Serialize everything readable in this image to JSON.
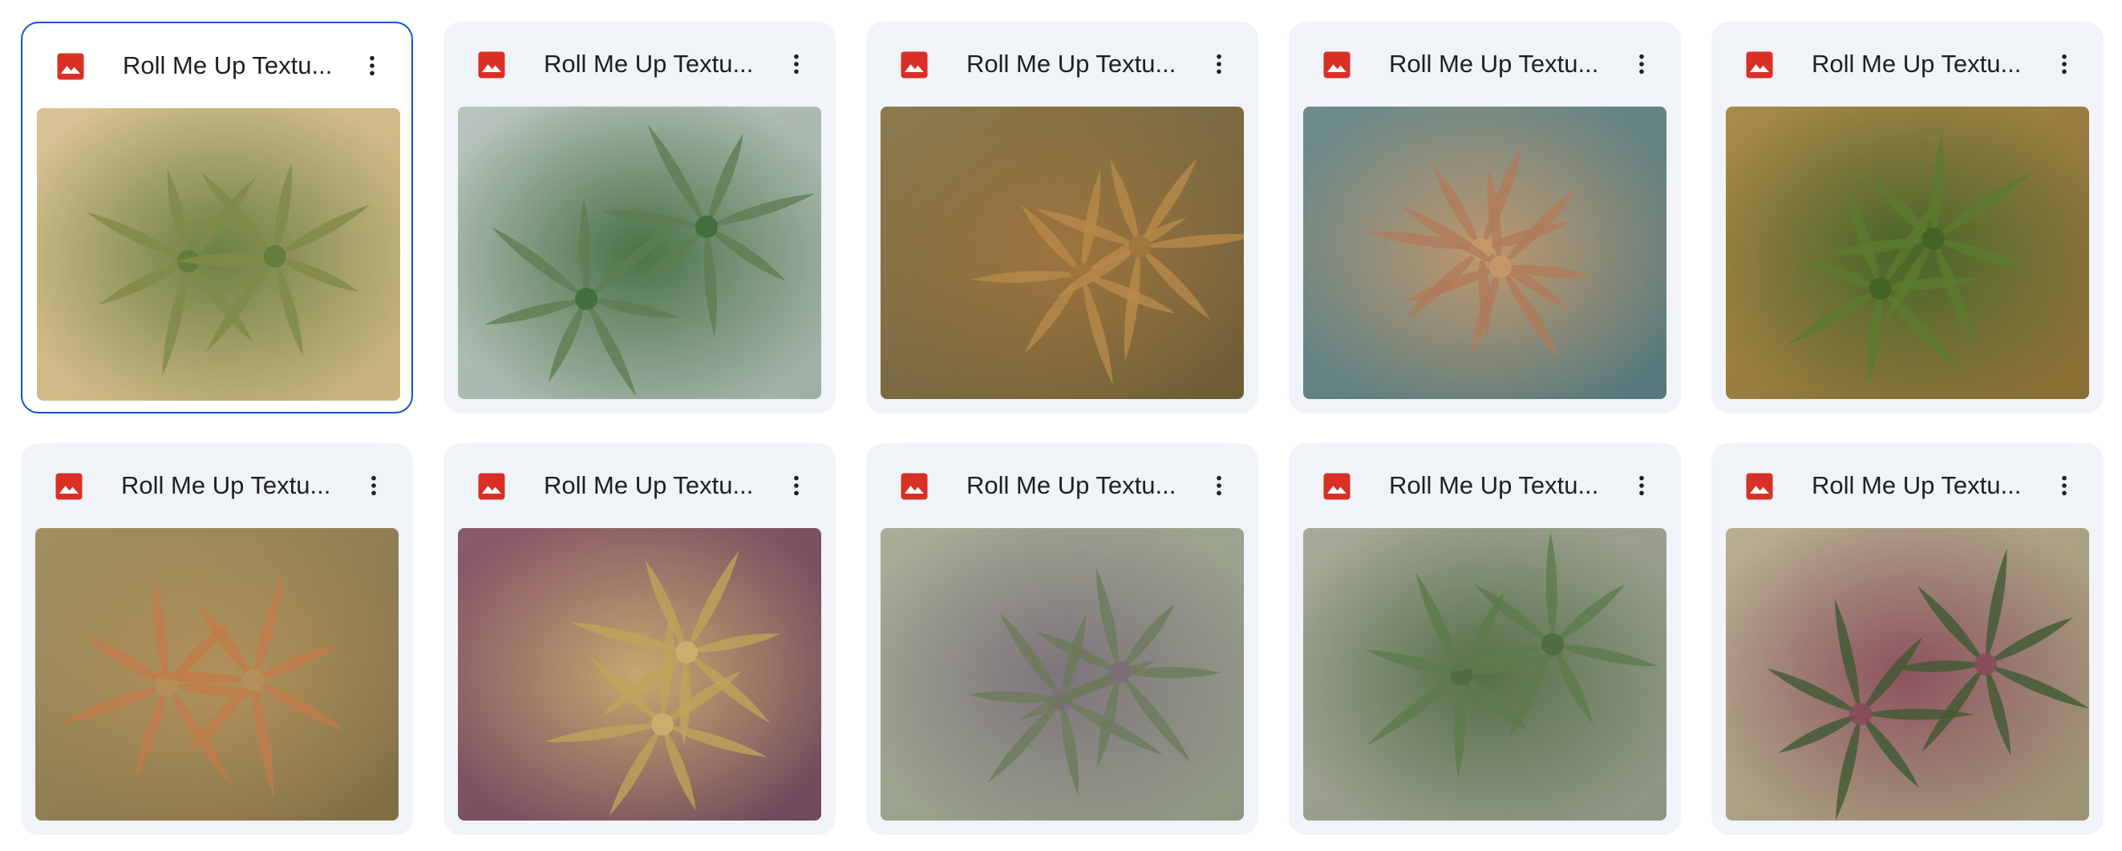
{
  "files": [
    {
      "title": "Roll Me Up Textu...",
      "selected": true,
      "icon": "image-file-icon",
      "colors": [
        "#d9c296",
        "#c8b27c",
        "#7f8a4a",
        "#5f7a3a"
      ]
    },
    {
      "title": "Roll Me Up Textu...",
      "selected": false,
      "icon": "image-file-icon",
      "colors": [
        "#b8c4bd",
        "#9fb0a6",
        "#5e7d52",
        "#3f6a3a"
      ]
    },
    {
      "title": "Roll Me Up Textu...",
      "selected": false,
      "icon": "image-file-icon",
      "colors": [
        "#8a7a4e",
        "#6d5c36",
        "#b88a4a",
        "#a0743c"
      ]
    },
    {
      "title": "Roll Me Up Textu...",
      "selected": false,
      "icon": "image-file-icon",
      "colors": [
        "#6f8c8c",
        "#56787a",
        "#b07a5a",
        "#c99a6a"
      ]
    },
    {
      "title": "Roll Me Up Textu...",
      "selected": false,
      "icon": "image-file-icon",
      "colors": [
        "#a88a4a",
        "#8a6e34",
        "#5b7a2e",
        "#3f6326"
      ]
    },
    {
      "title": "Roll Me Up Textu...",
      "selected": false,
      "icon": "image-file-icon",
      "colors": [
        "#a09060",
        "#7f6e44",
        "#c07a4a",
        "#b5925a"
      ]
    },
    {
      "title": "Roll Me Up Textu...",
      "selected": false,
      "icon": "image-file-icon",
      "colors": [
        "#8a5a6a",
        "#6e4a5a",
        "#c0a25a",
        "#d0b070"
      ]
    },
    {
      "title": "Roll Me Up Textu...",
      "selected": false,
      "icon": "image-file-icon",
      "colors": [
        "#a8ae98",
        "#8e9682",
        "#6b7a5a",
        "#7a6e7a"
      ]
    },
    {
      "title": "Roll Me Up Textu...",
      "selected": false,
      "icon": "image-file-icon",
      "colors": [
        "#a8aa98",
        "#8c9482",
        "#5e7a4e",
        "#4e6a40"
      ]
    },
    {
      "title": "Roll Me Up Textu...",
      "selected": false,
      "icon": "image-file-icon",
      "colors": [
        "#b8ae92",
        "#9c9274",
        "#3e5a32",
        "#8a4a5a"
      ]
    }
  ],
  "icon_color": "#d93025",
  "selection_color": "#0b57d0"
}
